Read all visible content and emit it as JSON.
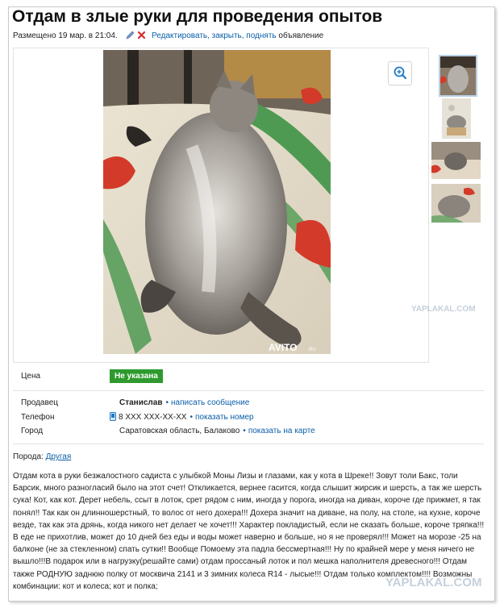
{
  "listing": {
    "title": "Отдам в злые руки для проведения опытов",
    "meta": {
      "posted": "Размещено 19 мар. в 21:04.",
      "actions_link": "Редактировать, закрыть, поднять",
      "actions_suffix": "объявление"
    },
    "gallery": {
      "main_photo_watermark": "AVITO",
      "main_photo_watermark_suffix": "RU",
      "thumbnails": 4
    },
    "price": {
      "label": "Цена",
      "value": "Не указана",
      "badge_color": "#2e9a2e"
    },
    "seller": {
      "label": "Продавец",
      "name": "Станислав",
      "action": "написать сообщение"
    },
    "phone": {
      "label": "Телефон",
      "number": "8 XXX XXX-XX-XX",
      "action": "показать номер"
    },
    "city": {
      "label": "Город",
      "value": "Саратовская область, Балаково",
      "action": "показать на карте"
    },
    "breed": {
      "label": "Порода:",
      "value": "Другая"
    },
    "description": "Отдам кота в руки безжалостного садиста с улыбкой Моны Лизы и глазами, как у кота в Шреке!! Зовут толи Бакс, толи Барсик, много разногласий было на этот счет! Откликается, вернее гасится, когда слышит жирсик и шерсть, а так же шерсть сука! Кот, как кот. Дерет небель, ссыт в лоток, срет рядом с ним, иногда у порога, иногда на диван, короче где прижмет, я так понял!! Так как он длинношерстный, то волос от него дохера!!! Дохера значит на диване, на полу, на столе, на кухне, короче везде, так как эта дрянь, когда никого нет делает че хочет!!! Характер покладистый, если не сказать больше, короче тряпка!!! В еде не прихотлив, может до 10 дней без еды и воды может наверно и больше, но я не проверял!!! Может на морозе -25 на балконе (не за стекленном) спать сутки!! Вообще Помоему эта падла бессмертная!!! Ну по крайней мере у меня ничего не вышло!!!В подарок или в нагрузку(решайте сами) отдам проссаный лоток и пол мешка наполнителя древесного!!! Отдам также РОДНУЮ заднюю полку от москвича 2141 и 3 зимних колеса R14 - лысые!!! Отдам только комплектом!!!! Возможны комбинации: кот и колеса; кот и полка;"
  },
  "watermark": {
    "site_mid": "YAPLAKAL.COM",
    "site_bottom": "YAPLAKAL.COM"
  },
  "colors": {
    "link": "#0b5ea8",
    "delete": "#d62b2b",
    "badge": "#2e9a2e"
  }
}
